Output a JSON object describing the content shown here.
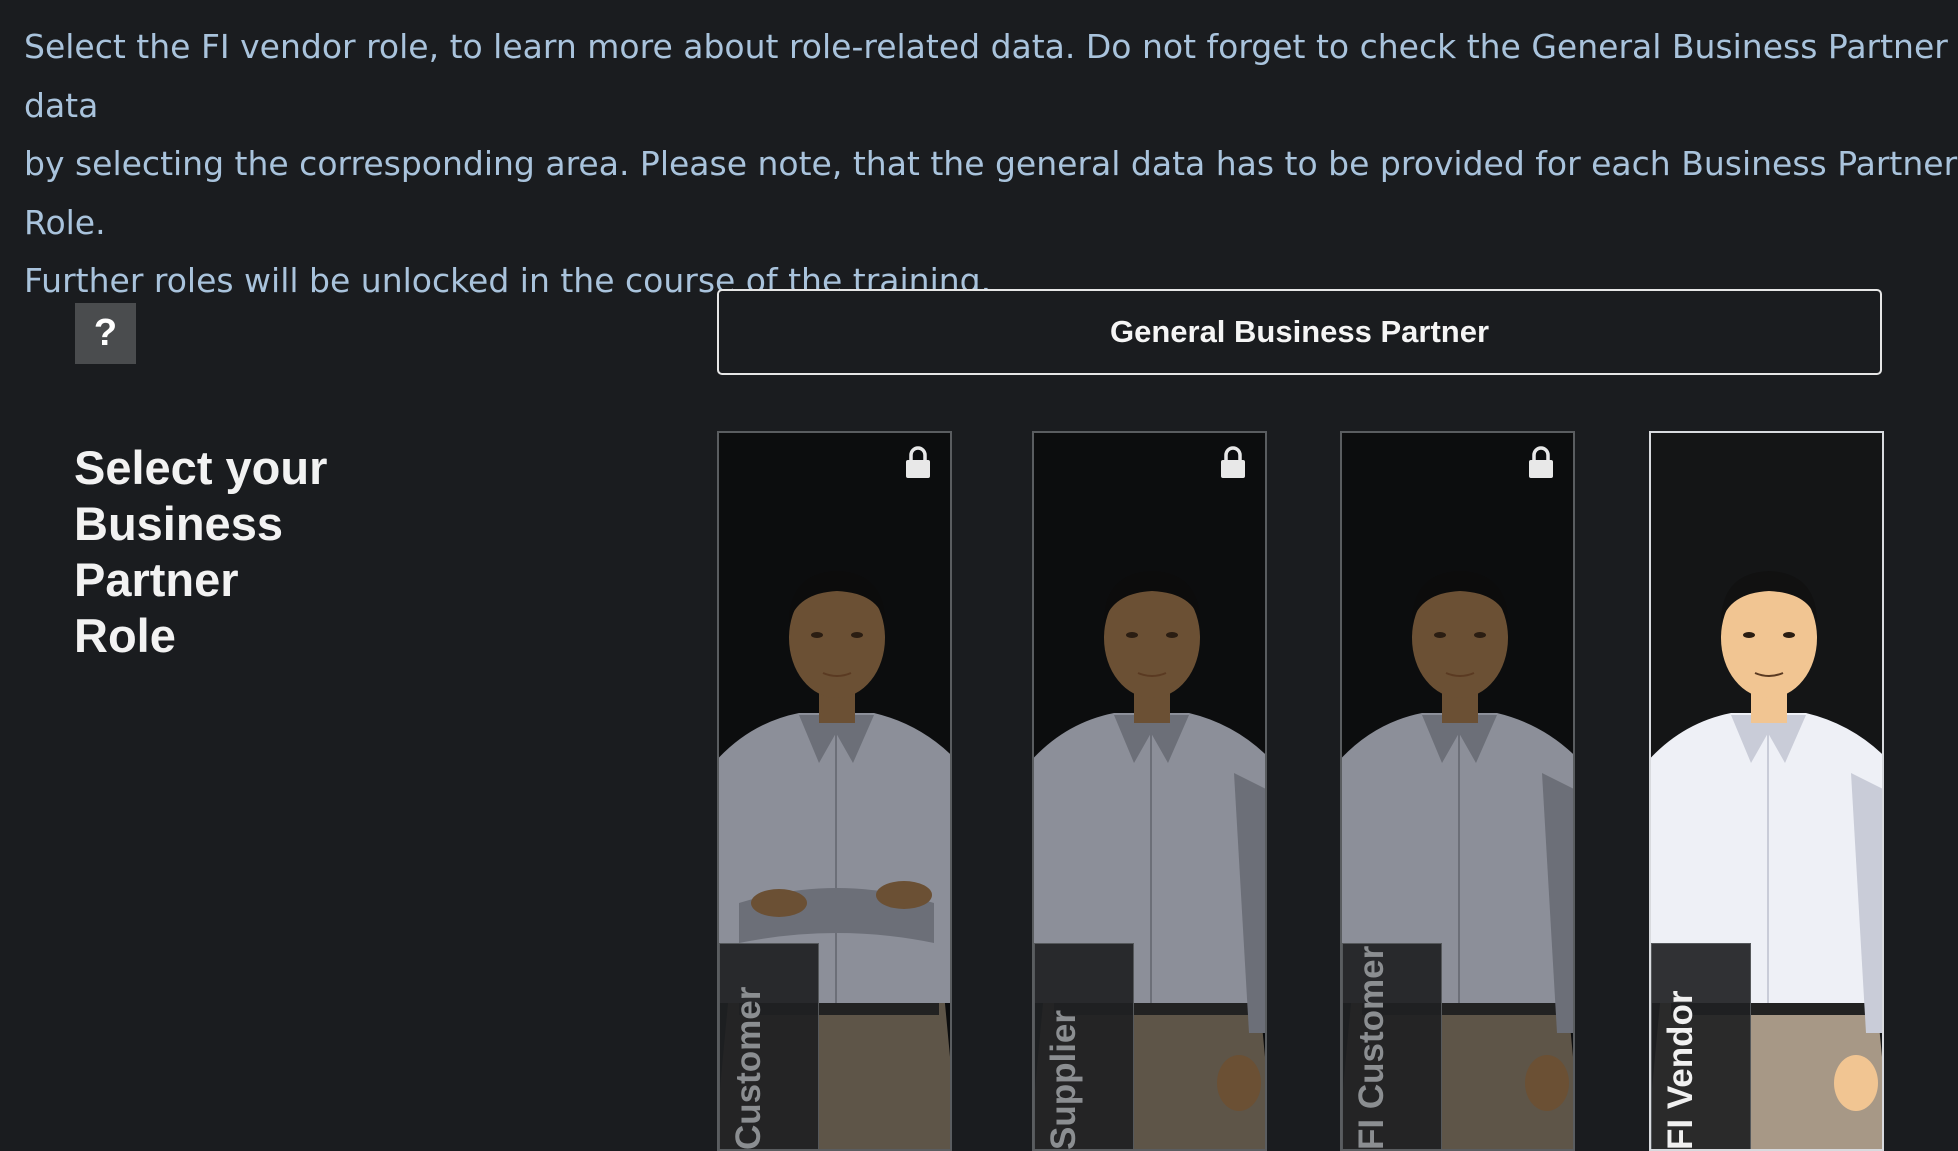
{
  "instructions": "Select the FI vendor role, to learn more about role-related data. Do not forget to check the General Business Partner data\nby selecting the corresponding area. Please note, that the general data has to be provided for each Business Partner Role.\nFurther roles will be unlocked in the course of the training.",
  "help_button": "?",
  "heading": "Select your Business Partner Role",
  "general_button": "General Business Partner",
  "roles": [
    {
      "label": "Customer",
      "locked": true,
      "active": false
    },
    {
      "label": "Supplier",
      "locked": true,
      "active": false
    },
    {
      "label": "FI Customer",
      "locked": true,
      "active": false
    },
    {
      "label": "FI Vendor",
      "locked": false,
      "active": true
    }
  ],
  "icons": {
    "lock": "lock-icon",
    "help": "question-icon"
  },
  "colors": {
    "background": "#1a1c1f",
    "instruction_text": "#a9c3dc",
    "locked_card": "#0c0d0e",
    "active_border": "#d8dade"
  }
}
